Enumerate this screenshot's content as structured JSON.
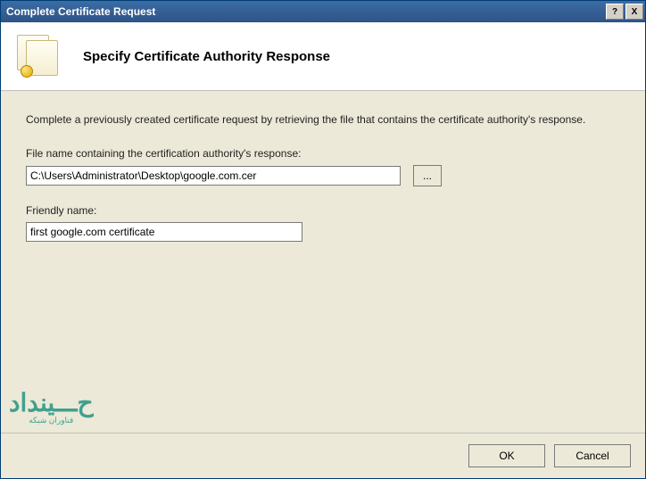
{
  "titlebar": {
    "title": "Complete Certificate Request",
    "help_label": "?",
    "close_label": "X"
  },
  "header": {
    "title": "Specify Certificate Authority Response"
  },
  "content": {
    "intro": "Complete a previously created certificate request by retrieving the file that contains the certificate authority's response.",
    "file_label": "File name containing the certification authority's response:",
    "file_value": "C:\\Users\\Administrator\\Desktop\\google.com.cer",
    "browse_label": "...",
    "friendly_label": "Friendly name:",
    "friendly_value": "first google.com certificate"
  },
  "footer": {
    "ok_label": "OK",
    "cancel_label": "Cancel"
  },
  "watermark": {
    "main": "ح‌ـــینداد",
    "sub": "فناوران شبکه"
  }
}
